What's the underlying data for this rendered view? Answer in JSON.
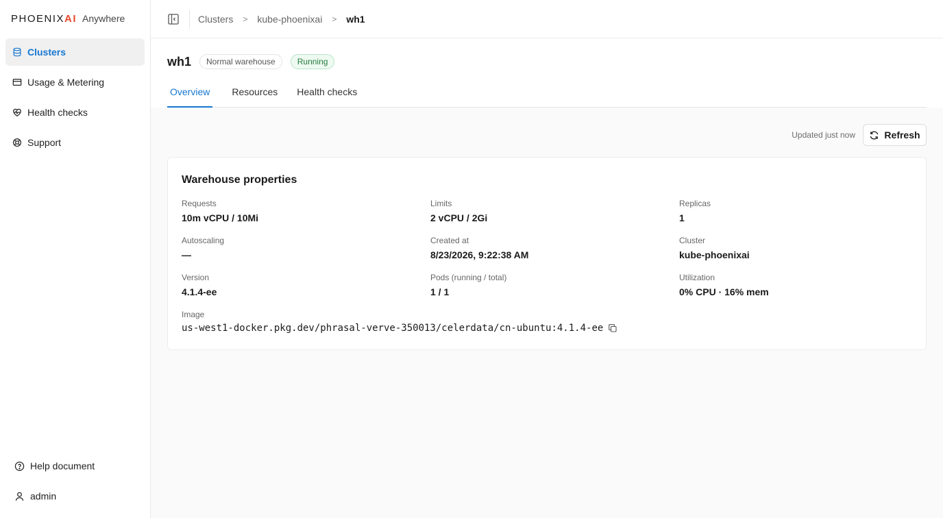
{
  "brand": {
    "logo_main": "PHOENIX",
    "logo_ai": "AI",
    "logo_sub": "Anywhere"
  },
  "sidebar": {
    "items": [
      {
        "label": "Clusters",
        "icon": "database-icon",
        "active": true
      },
      {
        "label": "Usage & Metering",
        "icon": "card-icon",
        "active": false
      },
      {
        "label": "Health checks",
        "icon": "heart-pulse-icon",
        "active": false
      },
      {
        "label": "Support",
        "icon": "lifebuoy-icon",
        "active": false
      }
    ],
    "help_label": "Help document",
    "user_label": "admin"
  },
  "breadcrumb": {
    "root": "Clusters",
    "cluster": "kube-phoenixai",
    "current": "wh1"
  },
  "header": {
    "title": "wh1",
    "type_tag": "Normal warehouse",
    "status_tag": "Running",
    "status_color": "#237a3b"
  },
  "tabs": [
    {
      "label": "Overview",
      "active": true
    },
    {
      "label": "Resources",
      "active": false
    },
    {
      "label": "Health checks",
      "active": false
    }
  ],
  "toolbar": {
    "updated_text": "Updated just now",
    "refresh_label": "Refresh"
  },
  "properties": {
    "title": "Warehouse properties",
    "requests_label": "Requests",
    "requests_value": "10m vCPU / 10Mi",
    "limits_label": "Limits",
    "limits_value": "2 vCPU / 2Gi",
    "replicas_label": "Replicas",
    "replicas_value": "1",
    "autoscaling_label": "Autoscaling",
    "autoscaling_value": "—",
    "created_label": "Created at",
    "created_value": "8/23/2026, 9:22:38 AM",
    "cluster_label": "Cluster",
    "cluster_value": "kube-phoenixai",
    "version_label": "Version",
    "version_value": "4.1.4-ee",
    "pods_label": "Pods (running / total)",
    "pods_value": "1 / 1",
    "utilization_label": "Utilization",
    "utilization_value": "0% CPU · 16% mem",
    "image_label": "Image",
    "image_value": "us-west1-docker.pkg.dev/phrasal-verve-350013/celerdata/cn-ubuntu:4.1.4-ee"
  },
  "colors": {
    "accent": "#1677d2",
    "brand_ai": "#e8482c"
  }
}
